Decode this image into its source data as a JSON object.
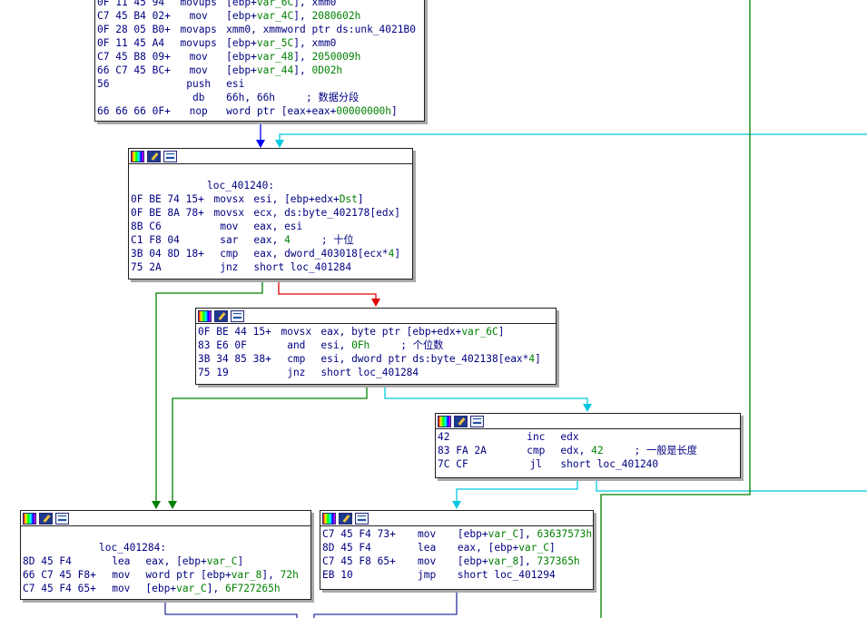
{
  "colors": {
    "edge_blue": "#0000ff",
    "edge_green": "#008000",
    "edge_red": "#e00000",
    "edge_cyan": "#00c8e0",
    "edge_dark": "#3030a0",
    "text": "#000080",
    "name": "#008000"
  },
  "node_icons": [
    "color-icon",
    "rename-icon",
    "graph-icon"
  ],
  "nodes": {
    "top": {
      "lines": [
        {
          "bytes": "0F 11 45 94",
          "mnem": "movups",
          "op": "[ebp+var_6C], xmm0"
        },
        {
          "bytes": "C7 45 B4 02+",
          "mnem": "mov",
          "op": "[ebp+var_4C], 2080602h"
        },
        {
          "bytes": "0F 28 05 B0+",
          "mnem": "movaps",
          "op": "xmm0, xmmword ptr ds:unk_4021B0"
        },
        {
          "bytes": "0F 11 45 A4",
          "mnem": "movups",
          "op": "[ebp+var_5C], xmm0"
        },
        {
          "bytes": "C7 45 B8 09+",
          "mnem": "mov",
          "op": "[ebp+var_48], 2050009h"
        },
        {
          "bytes": "66 C7 45 BC+",
          "mnem": "mov",
          "op": "[ebp+var_44], 0D02h"
        },
        {
          "bytes": "56",
          "mnem": "push",
          "op": "esi"
        },
        {
          "bytes": "",
          "mnem": "db",
          "op": "66h, 66h",
          "cmt": "; 数据分段"
        },
        {
          "bytes": "66 66 66 0F+",
          "mnem": "nop",
          "op": "word ptr [eax+eax+00000000h]"
        }
      ]
    },
    "loc240": {
      "label": "loc_401240:",
      "lines": [
        {
          "bytes": "0F BE 74 15+",
          "mnem": "movsx",
          "op": "esi, [ebp+edx+Dst]"
        },
        {
          "bytes": "0F BE 8A 78+",
          "mnem": "movsx",
          "op": "ecx, ds:byte_402178[edx]"
        },
        {
          "bytes": "8B C6",
          "mnem": "mov",
          "op": "eax, esi"
        },
        {
          "bytes": "C1 F8 04",
          "mnem": "sar",
          "op": "eax, 4",
          "cmt": "; 十位"
        },
        {
          "bytes": "3B 04 8D 18+",
          "mnem": "cmp",
          "op": "eax, dword_403018[ecx*4]"
        },
        {
          "bytes": "75 2A",
          "mnem": "jnz",
          "op": "short loc_401284"
        }
      ]
    },
    "mid": {
      "lines": [
        {
          "bytes": "0F BE 44 15+",
          "mnem": "movsx",
          "op": "eax, byte ptr [ebp+edx+var_6C]"
        },
        {
          "bytes": "83 E6 0F",
          "mnem": "and",
          "op": "esi, 0Fh",
          "cmt": "; 个位数"
        },
        {
          "bytes": "3B 34 85 38+",
          "mnem": "cmp",
          "op": "esi, dword ptr ds:byte_402138[eax*4]"
        },
        {
          "bytes": "75 19",
          "mnem": "jnz",
          "op": "short loc_401284"
        }
      ]
    },
    "inc": {
      "lines": [
        {
          "bytes": "42",
          "mnem": "inc",
          "op": "edx"
        },
        {
          "bytes": "83 FA 2A",
          "mnem": "cmp",
          "op": "edx, 42",
          "cmt": "; 一般是长度"
        },
        {
          "bytes": "7C CF",
          "mnem": "jl",
          "op": "short loc_401240"
        }
      ]
    },
    "loc284": {
      "label": "loc_401284:",
      "lines": [
        {
          "bytes": "8D 45 F4",
          "mnem": "lea",
          "op": "eax, [ebp+var_C]"
        },
        {
          "bytes": "66 C7 45 F8+",
          "mnem": "mov",
          "op": "word ptr [ebp+var_8], 72h"
        },
        {
          "bytes": "C7 45 F4 65+",
          "mnem": "mov",
          "op": "[ebp+var_C], 6F727265h"
        }
      ]
    },
    "right": {
      "lines": [
        {
          "bytes": "C7 45 F4 73+",
          "mnem": "mov",
          "op": "[ebp+var_C], 63637573h"
        },
        {
          "bytes": "8D 45 F4",
          "mnem": "lea",
          "op": "eax, [ebp+var_C]"
        },
        {
          "bytes": "C7 45 F8 65+",
          "mnem": "mov",
          "op": "[ebp+var_8], 737365h"
        },
        {
          "bytes": "EB 10",
          "mnem": "jmp",
          "op": "short loc_401294"
        }
      ]
    }
  }
}
